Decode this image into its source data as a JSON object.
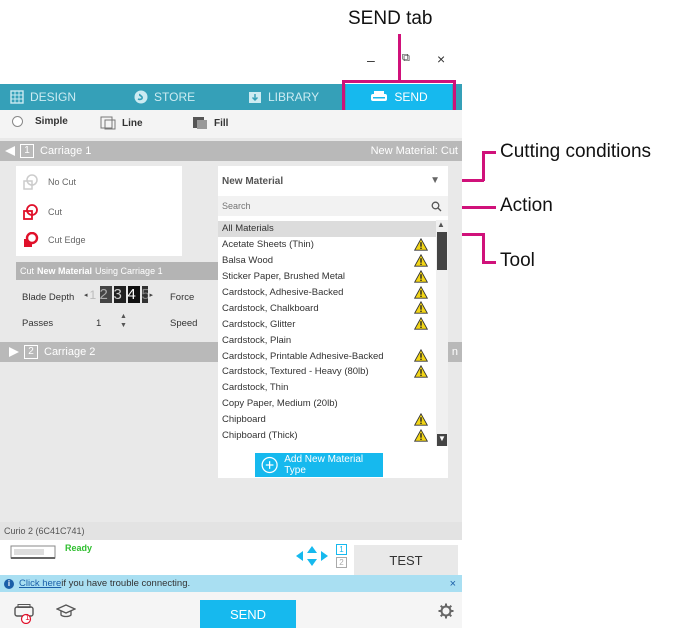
{
  "annotations": {
    "send_tab": "SEND tab",
    "cutting_conditions": "Cutting conditions",
    "action": "Action",
    "tool": "Tool"
  },
  "window": {
    "minimize": "–",
    "restore": "⧉",
    "close": "×"
  },
  "tabs": [
    {
      "label": "DESIGN",
      "icon": "grid-icon"
    },
    {
      "label": "STORE",
      "icon": "silhouette-s-icon"
    },
    {
      "label": "LIBRARY",
      "icon": "library-icon"
    },
    {
      "label": "SEND",
      "icon": "cutter-icon"
    }
  ],
  "modes": {
    "simple": "Simple",
    "line": "Line",
    "fill": "Fill"
  },
  "carriage1": {
    "num": "1",
    "label": "Carriage 1",
    "material_summary": "New Material: Cut"
  },
  "carriage2": {
    "num": "2",
    "label": "Carriage 2",
    "right_fragment": "n"
  },
  "tools": {
    "no_cut": "No Cut",
    "cut": "Cut",
    "cut_edge": "Cut Edge"
  },
  "cut_using": {
    "prefix": "Cut ",
    "material": "New Material",
    "suffix": " Using Carriage 1"
  },
  "settings": {
    "blade_depth_label": "Blade Depth",
    "blade_digits": [
      "1",
      "2",
      "3",
      "4",
      "5"
    ],
    "force_label": "Force",
    "passes_label": "Passes",
    "passes_value": "1",
    "speed_label": "Speed"
  },
  "material_panel": {
    "selected": "New Material",
    "search_placeholder": "Search",
    "header": "All Materials",
    "items": [
      {
        "name": "Acetate Sheets (Thin)",
        "warn": true
      },
      {
        "name": "Balsa Wood",
        "warn": true
      },
      {
        "name": "Sticker Paper, Brushed Metal",
        "warn": true
      },
      {
        "name": "Cardstock, Adhesive-Backed",
        "warn": true
      },
      {
        "name": "Cardstock, Chalkboard",
        "warn": true
      },
      {
        "name": "Cardstock, Glitter",
        "warn": true
      },
      {
        "name": "Cardstock, Plain",
        "warn": false
      },
      {
        "name": "Cardstock, Printable Adhesive-Backed",
        "warn": true
      },
      {
        "name": "Cardstock, Textured - Heavy (80lb)",
        "warn": true
      },
      {
        "name": "Cardstock, Thin",
        "warn": false
      },
      {
        "name": "Copy Paper, Medium (20lb)",
        "warn": false
      },
      {
        "name": "Chipboard",
        "warn": true
      },
      {
        "name": "Chipboard (Thick)",
        "warn": true
      }
    ],
    "add_button": "Add New Material Type"
  },
  "device": {
    "name": "Curio 2 (6C41C741)",
    "status": "Ready",
    "carriage_nums": [
      "1",
      "2"
    ]
  },
  "test_button": "TEST",
  "info": {
    "link": "Click here",
    "text": " if you have trouble connecting.",
    "close": "×"
  },
  "send_button": "SEND",
  "footer_badge": "1",
  "colors": {
    "accent": "#16b9ee",
    "annotation": "#d0117a",
    "cut_red": "#e0102a",
    "ready_green": "#2fbf2f",
    "warning": "#f2d516"
  }
}
